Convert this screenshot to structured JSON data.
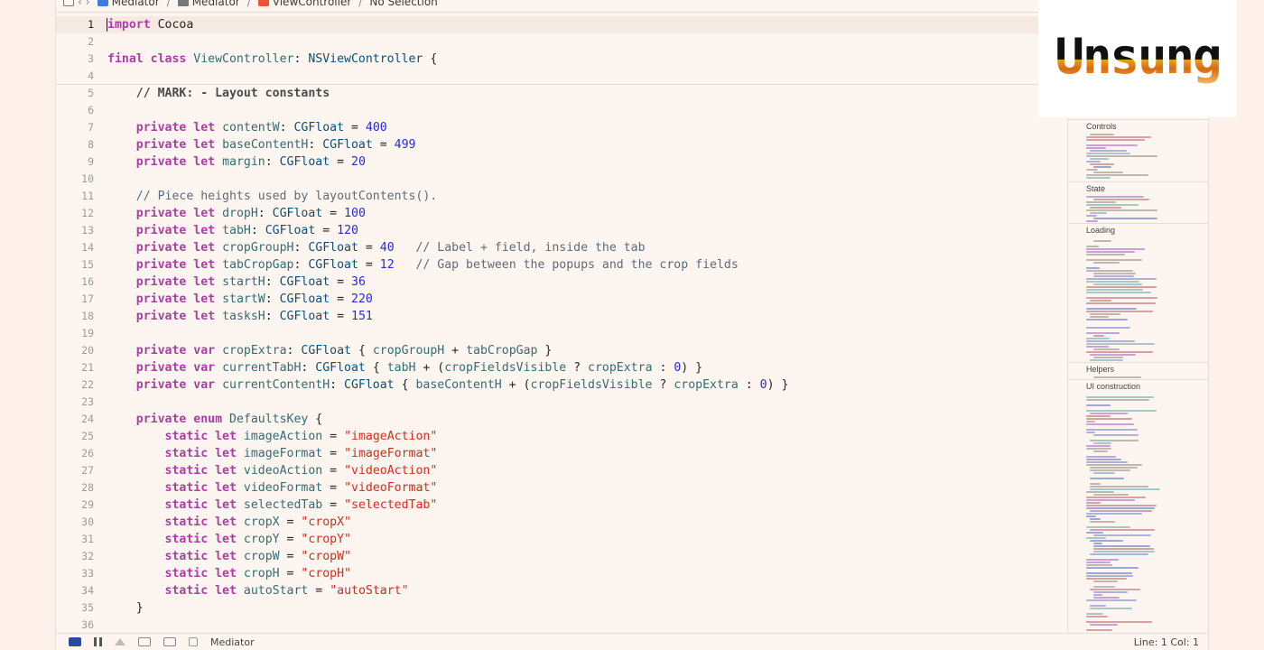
{
  "jumpbar": {
    "crumbs": [
      "Mediator",
      "Mediator",
      "ViewController",
      "No Selection"
    ]
  },
  "editor": {
    "current_line": 1,
    "lines": [
      {
        "n": "1",
        "tokens": [
          [
            "kw",
            "import"
          ],
          [
            "p",
            " Cocoa"
          ]
        ]
      },
      {
        "n": "2",
        "tokens": []
      },
      {
        "n": "3",
        "tokens": [
          [
            "kw",
            "final class"
          ],
          [
            "p",
            " "
          ],
          [
            "id",
            "ViewController"
          ],
          [
            "p",
            ": "
          ],
          [
            "ty",
            "NSViewController"
          ],
          [
            "p",
            " {"
          ]
        ]
      },
      {
        "n": "4",
        "tokens": []
      },
      {
        "n": "5",
        "tokens": [
          [
            "p",
            "    "
          ],
          [
            "mk",
            "// MARK: - Layout constants"
          ]
        ]
      },
      {
        "n": "6",
        "tokens": []
      },
      {
        "n": "7",
        "tokens": [
          [
            "p",
            "    "
          ],
          [
            "kw",
            "private let"
          ],
          [
            "p",
            " "
          ],
          [
            "id",
            "contentW"
          ],
          [
            "p",
            ": "
          ],
          [
            "ty",
            "CGFloat"
          ],
          [
            "p",
            " = "
          ],
          [
            "num",
            "400"
          ]
        ]
      },
      {
        "n": "8",
        "tokens": [
          [
            "p",
            "    "
          ],
          [
            "kw",
            "private let"
          ],
          [
            "p",
            " "
          ],
          [
            "id",
            "baseContentH"
          ],
          [
            "p",
            ": "
          ],
          [
            "ty",
            "CGFloat"
          ],
          [
            "p",
            " = "
          ],
          [
            "num",
            "499"
          ]
        ]
      },
      {
        "n": "9",
        "tokens": [
          [
            "p",
            "    "
          ],
          [
            "kw",
            "private let"
          ],
          [
            "p",
            " "
          ],
          [
            "id",
            "margin"
          ],
          [
            "p",
            ": "
          ],
          [
            "ty",
            "CGFloat"
          ],
          [
            "p",
            " = "
          ],
          [
            "num",
            "20"
          ]
        ]
      },
      {
        "n": "10",
        "tokens": []
      },
      {
        "n": "11",
        "tokens": [
          [
            "p",
            "    "
          ],
          [
            "cm",
            "// Piece heights used by layoutContents()."
          ]
        ]
      },
      {
        "n": "12",
        "tokens": [
          [
            "p",
            "    "
          ],
          [
            "kw",
            "private let"
          ],
          [
            "p",
            " "
          ],
          [
            "id",
            "dropH"
          ],
          [
            "p",
            ": "
          ],
          [
            "ty",
            "CGFloat"
          ],
          [
            "p",
            " = "
          ],
          [
            "num",
            "100"
          ]
        ]
      },
      {
        "n": "13",
        "tokens": [
          [
            "p",
            "    "
          ],
          [
            "kw",
            "private let"
          ],
          [
            "p",
            " "
          ],
          [
            "id",
            "tabH"
          ],
          [
            "p",
            ": "
          ],
          [
            "ty",
            "CGFloat"
          ],
          [
            "p",
            " = "
          ],
          [
            "num",
            "120"
          ]
        ]
      },
      {
        "n": "14",
        "tokens": [
          [
            "p",
            "    "
          ],
          [
            "kw",
            "private let"
          ],
          [
            "p",
            " "
          ],
          [
            "id",
            "cropGroupH"
          ],
          [
            "p",
            ": "
          ],
          [
            "ty",
            "CGFloat"
          ],
          [
            "p",
            " = "
          ],
          [
            "num",
            "40"
          ],
          [
            "p",
            "   "
          ],
          [
            "cm",
            "// Label + field, inside the tab"
          ]
        ]
      },
      {
        "n": "15",
        "tokens": [
          [
            "p",
            "    "
          ],
          [
            "kw",
            "private let"
          ],
          [
            "p",
            " "
          ],
          [
            "id",
            "tabCropGap"
          ],
          [
            "p",
            ": "
          ],
          [
            "ty",
            "CGFloat"
          ],
          [
            "p",
            " = "
          ],
          [
            "num",
            "12"
          ],
          [
            "p",
            "   "
          ],
          [
            "cm",
            "// Gap between the popups and the crop fields"
          ]
        ]
      },
      {
        "n": "16",
        "tokens": [
          [
            "p",
            "    "
          ],
          [
            "kw",
            "private let"
          ],
          [
            "p",
            " "
          ],
          [
            "id",
            "startH"
          ],
          [
            "p",
            ": "
          ],
          [
            "ty",
            "CGFloat"
          ],
          [
            "p",
            " = "
          ],
          [
            "num",
            "36"
          ]
        ]
      },
      {
        "n": "17",
        "tokens": [
          [
            "p",
            "    "
          ],
          [
            "kw",
            "private let"
          ],
          [
            "p",
            " "
          ],
          [
            "id",
            "startW"
          ],
          [
            "p",
            ": "
          ],
          [
            "ty",
            "CGFloat"
          ],
          [
            "p",
            " = "
          ],
          [
            "num",
            "220"
          ]
        ]
      },
      {
        "n": "18",
        "tokens": [
          [
            "p",
            "    "
          ],
          [
            "kw",
            "private let"
          ],
          [
            "p",
            " "
          ],
          [
            "id",
            "tasksH"
          ],
          [
            "p",
            ": "
          ],
          [
            "ty",
            "CGFloat"
          ],
          [
            "p",
            " = "
          ],
          [
            "num",
            "151"
          ]
        ]
      },
      {
        "n": "19",
        "tokens": []
      },
      {
        "n": "20",
        "tokens": [
          [
            "p",
            "    "
          ],
          [
            "kw",
            "private var"
          ],
          [
            "p",
            " "
          ],
          [
            "id",
            "cropExtra"
          ],
          [
            "p",
            ": "
          ],
          [
            "ty",
            "CGFloat"
          ],
          [
            "p",
            " { "
          ],
          [
            "id",
            "cropGroupH"
          ],
          [
            "p",
            " + "
          ],
          [
            "id",
            "tabCropGap"
          ],
          [
            "p",
            " }"
          ]
        ]
      },
      {
        "n": "21",
        "tokens": [
          [
            "p",
            "    "
          ],
          [
            "kw",
            "private var"
          ],
          [
            "p",
            " "
          ],
          [
            "id",
            "currentTabH"
          ],
          [
            "p",
            ": "
          ],
          [
            "ty",
            "CGFloat"
          ],
          [
            "p",
            " { "
          ],
          [
            "id",
            "tabH"
          ],
          [
            "p",
            " + ("
          ],
          [
            "id",
            "cropFieldsVisible"
          ],
          [
            "p",
            " ? "
          ],
          [
            "id",
            "cropExtra"
          ],
          [
            "p",
            " : "
          ],
          [
            "num",
            "0"
          ],
          [
            "p",
            ") }"
          ]
        ]
      },
      {
        "n": "22",
        "tokens": [
          [
            "p",
            "    "
          ],
          [
            "kw",
            "private var"
          ],
          [
            "p",
            " "
          ],
          [
            "id",
            "currentContentH"
          ],
          [
            "p",
            ": "
          ],
          [
            "ty",
            "CGFloat"
          ],
          [
            "p",
            " { "
          ],
          [
            "id",
            "baseContentH"
          ],
          [
            "p",
            " + ("
          ],
          [
            "id",
            "cropFieldsVisible"
          ],
          [
            "p",
            " ? "
          ],
          [
            "id",
            "cropExtra"
          ],
          [
            "p",
            " : "
          ],
          [
            "num",
            "0"
          ],
          [
            "p",
            ") }"
          ]
        ]
      },
      {
        "n": "23",
        "tokens": []
      },
      {
        "n": "24",
        "tokens": [
          [
            "p",
            "    "
          ],
          [
            "kw",
            "private enum"
          ],
          [
            "p",
            " "
          ],
          [
            "id",
            "DefaultsKey"
          ],
          [
            "p",
            " {"
          ]
        ]
      },
      {
        "n": "25",
        "tokens": [
          [
            "p",
            "        "
          ],
          [
            "kw",
            "static let"
          ],
          [
            "p",
            " "
          ],
          [
            "id",
            "imageAction"
          ],
          [
            "p",
            " = "
          ],
          [
            "str",
            "\"imageAction\""
          ]
        ]
      },
      {
        "n": "26",
        "tokens": [
          [
            "p",
            "        "
          ],
          [
            "kw",
            "static let"
          ],
          [
            "p",
            " "
          ],
          [
            "id",
            "imageFormat"
          ],
          [
            "p",
            " = "
          ],
          [
            "str",
            "\"imageFormat\""
          ]
        ]
      },
      {
        "n": "27",
        "tokens": [
          [
            "p",
            "        "
          ],
          [
            "kw",
            "static let"
          ],
          [
            "p",
            " "
          ],
          [
            "id",
            "videoAction"
          ],
          [
            "p",
            " = "
          ],
          [
            "str",
            "\"videoAction\""
          ]
        ]
      },
      {
        "n": "28",
        "tokens": [
          [
            "p",
            "        "
          ],
          [
            "kw",
            "static let"
          ],
          [
            "p",
            " "
          ],
          [
            "id",
            "videoFormat"
          ],
          [
            "p",
            " = "
          ],
          [
            "str",
            "\"videoFormat\""
          ]
        ]
      },
      {
        "n": "29",
        "tokens": [
          [
            "p",
            "        "
          ],
          [
            "kw",
            "static let"
          ],
          [
            "p",
            " "
          ],
          [
            "id",
            "selectedTab"
          ],
          [
            "p",
            " = "
          ],
          [
            "str",
            "\"selectedTab\""
          ]
        ]
      },
      {
        "n": "30",
        "tokens": [
          [
            "p",
            "        "
          ],
          [
            "kw",
            "static let"
          ],
          [
            "p",
            " "
          ],
          [
            "id",
            "cropX"
          ],
          [
            "p",
            " = "
          ],
          [
            "str",
            "\"cropX\""
          ]
        ]
      },
      {
        "n": "31",
        "tokens": [
          [
            "p",
            "        "
          ],
          [
            "kw",
            "static let"
          ],
          [
            "p",
            " "
          ],
          [
            "id",
            "cropY"
          ],
          [
            "p",
            " = "
          ],
          [
            "str",
            "\"cropY\""
          ]
        ]
      },
      {
        "n": "32",
        "tokens": [
          [
            "p",
            "        "
          ],
          [
            "kw",
            "static let"
          ],
          [
            "p",
            " "
          ],
          [
            "id",
            "cropW"
          ],
          [
            "p",
            " = "
          ],
          [
            "str",
            "\"cropW\""
          ]
        ]
      },
      {
        "n": "33",
        "tokens": [
          [
            "p",
            "        "
          ],
          [
            "kw",
            "static let"
          ],
          [
            "p",
            " "
          ],
          [
            "id",
            "cropH"
          ],
          [
            "p",
            " = "
          ],
          [
            "str",
            "\"cropH\""
          ]
        ]
      },
      {
        "n": "34",
        "tokens": [
          [
            "p",
            "        "
          ],
          [
            "kw",
            "static let"
          ],
          [
            "p",
            " "
          ],
          [
            "id",
            "autoStart"
          ],
          [
            "p",
            " = "
          ],
          [
            "str",
            "\"autoStart\""
          ]
        ]
      },
      {
        "n": "35",
        "tokens": [
          [
            "p",
            "    }"
          ]
        ]
      },
      {
        "n": "36",
        "tokens": []
      }
    ]
  },
  "minimap": {
    "sections": [
      "Controls",
      "State",
      "Loading",
      "Helpers",
      "UI construction"
    ]
  },
  "statusbar": {
    "scheme": "Mediator",
    "position": "Line: 1  Col: 1"
  },
  "logo": {
    "text": "Unsung",
    "colors": [
      "#111111",
      "#e8a020",
      "#d96a10",
      "#c04a10"
    ]
  },
  "colors": {
    "keyword": "#ad3da4",
    "type": "#0b4f79",
    "identifier": "#326d74",
    "number": "#272ad8",
    "string": "#d12f1b",
    "comment": "#5d6c79"
  }
}
